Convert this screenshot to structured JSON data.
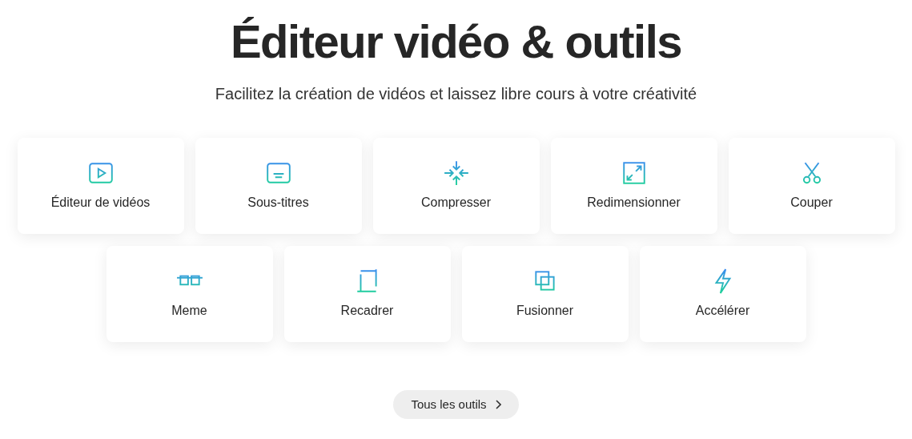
{
  "title": "Éditeur vidéo & outils",
  "subtitle": "Facilitez la création de vidéos et laissez libre cours à votre créativité",
  "tool_rows": [
    [
      {
        "label": "Éditeur de vidéos",
        "kind": "play"
      },
      {
        "label": "Sous-titres",
        "kind": "subtitles"
      },
      {
        "label": "Compresser",
        "kind": "compress"
      },
      {
        "label": "Redimensionner",
        "kind": "resize"
      },
      {
        "label": "Couper",
        "kind": "scissors"
      }
    ],
    [
      {
        "label": "Meme",
        "kind": "glasses"
      },
      {
        "label": "Recadrer",
        "kind": "crop"
      },
      {
        "label": "Fusionner",
        "kind": "merge"
      },
      {
        "label": "Accélérer",
        "kind": "bolt"
      }
    ]
  ],
  "all_tools_button": {
    "label": "Tous les outils"
  }
}
